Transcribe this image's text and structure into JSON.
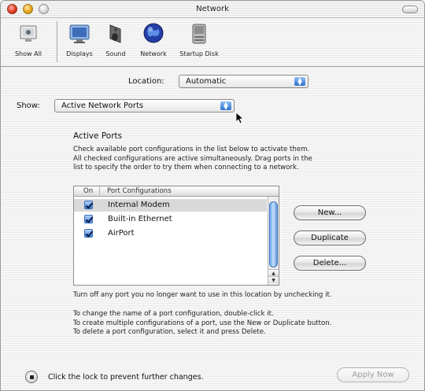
{
  "window": {
    "title": "Network"
  },
  "toolbar": {
    "items": [
      {
        "label": "Show All",
        "icon": "apple-icon"
      },
      {
        "label": "Displays",
        "icon": "displays-icon"
      },
      {
        "label": "Sound",
        "icon": "sound-icon"
      },
      {
        "label": "Network",
        "icon": "network-globe-icon"
      },
      {
        "label": "Startup Disk",
        "icon": "startup-disk-icon"
      }
    ]
  },
  "location": {
    "label": "Location:",
    "value": "Automatic"
  },
  "show": {
    "label": "Show:",
    "value": "Active Network Ports"
  },
  "active_ports": {
    "title": "Active Ports",
    "description": [
      "Check available port configurations in the list below to activate them.",
      "All checked configurations are active simultaneously. Drag ports in the",
      "list to specify the order to try them when connecting to a network."
    ],
    "columns": [
      "On",
      "Port Configurations"
    ],
    "rows": [
      {
        "label": "Internal Modem",
        "checked": true,
        "selected": true
      },
      {
        "label": "Built-in Ethernet",
        "checked": true,
        "selected": false
      },
      {
        "label": "AirPort",
        "checked": true,
        "selected": false
      }
    ]
  },
  "buttons": {
    "new": "New...",
    "duplicate": "Duplicate",
    "delete": "Delete...",
    "apply": "Apply Now"
  },
  "hints": {
    "turn_off": "Turn off any port you no longer want to use in this location by unchecking it.",
    "instructions": [
      "To change the name of a port configuration, double-click it.",
      "To create multiple configurations of a port, use the New or Duplicate button.",
      "To delete a port configuration, select it and press Delete."
    ]
  },
  "lock": {
    "text": "Click the lock to prevent further changes."
  },
  "colors": {
    "accent": "#2b6fd1",
    "selection": "#d9d9d9"
  }
}
